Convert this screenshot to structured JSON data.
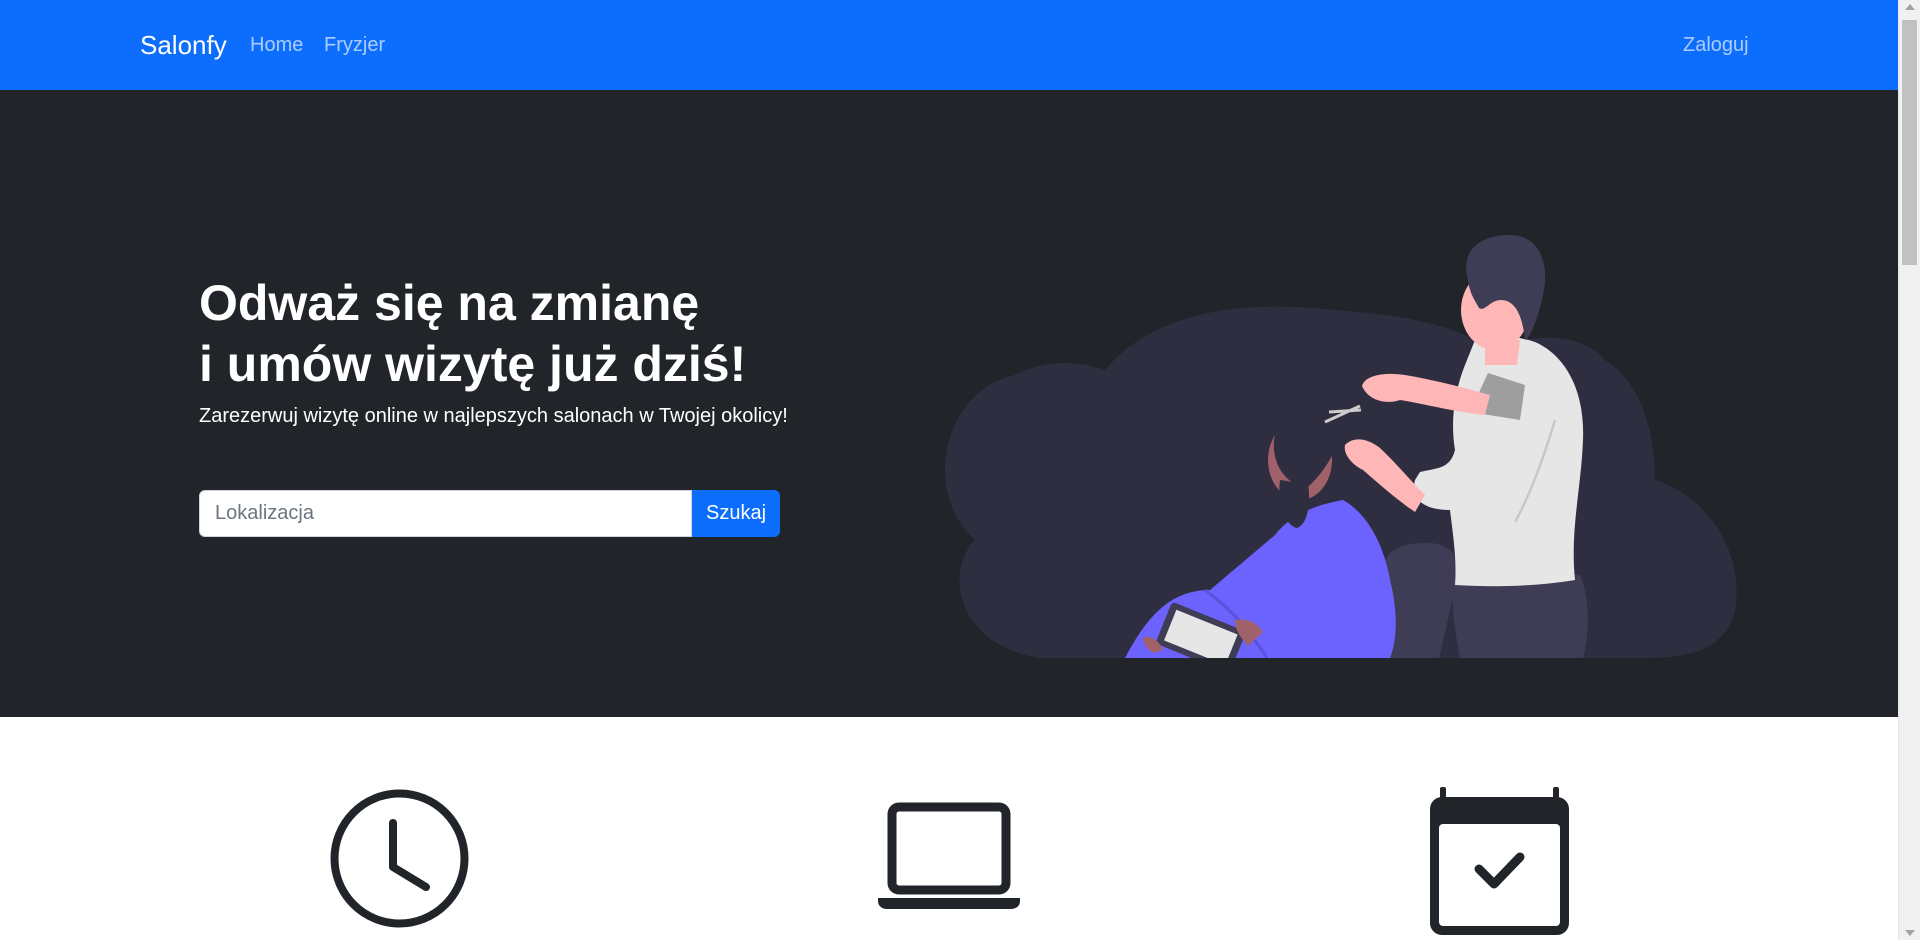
{
  "navbar": {
    "brand": "Salonfy",
    "links": [
      "Home",
      "Fryzjer"
    ],
    "login": "Zaloguj",
    "color": "#0d6efd"
  },
  "hero": {
    "title_line1": "Odważ się na zmianę",
    "title_line2": "i umów wizytę już dziś!",
    "subtitle": "Zarezerwuj wizytę online w najlepszych salonach w Twojej okolicy!",
    "search": {
      "placeholder": "Lokalizacja",
      "value": "",
      "button": "Szukaj"
    },
    "illustration": "barber-illustration",
    "background": "#212529"
  },
  "features": {
    "icons": [
      "clock-icon",
      "laptop-icon",
      "calendar-check-icon"
    ]
  }
}
